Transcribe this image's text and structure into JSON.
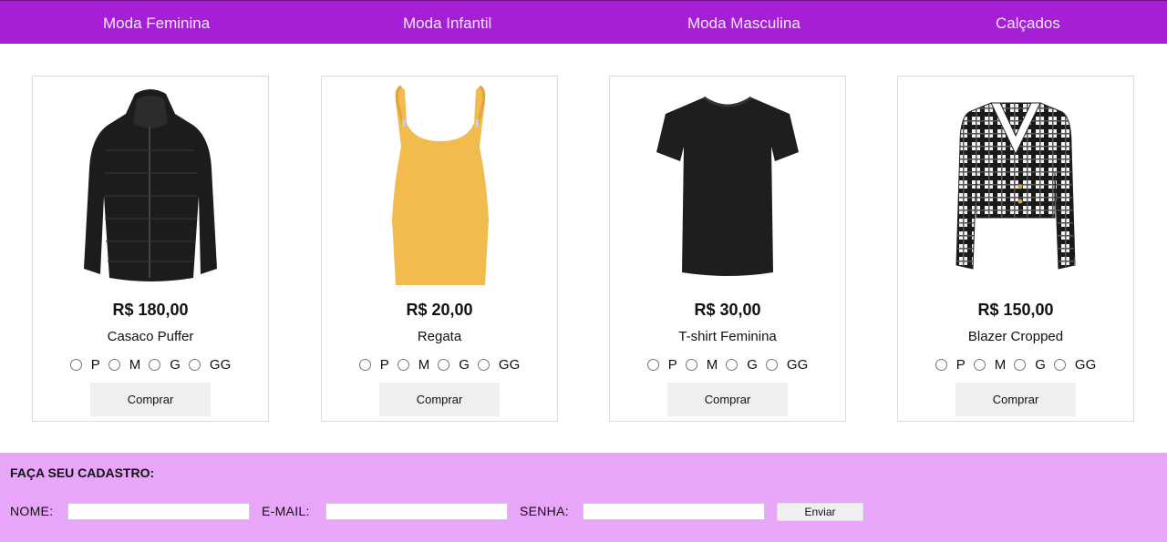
{
  "nav": {
    "items": [
      {
        "label": "Moda Feminina"
      },
      {
        "label": "Moda Infantil"
      },
      {
        "label": "Moda Masculina"
      },
      {
        "label": "Calçados"
      }
    ]
  },
  "products": [
    {
      "price": "R$ 180,00",
      "name": "Casaco Puffer",
      "buy_label": "Comprar",
      "image": "puffer-jacket-image"
    },
    {
      "price": "R$ 20,00",
      "name": "Regata",
      "buy_label": "Comprar",
      "image": "yellow-tank-top-image"
    },
    {
      "price": "R$ 30,00",
      "name": "T-shirt Feminina",
      "buy_label": "Comprar",
      "image": "black-tshirt-image"
    },
    {
      "price": "R$ 150,00",
      "name": "Blazer Cropped",
      "buy_label": "Comprar",
      "image": "plaid-blazer-image"
    }
  ],
  "sizes": [
    "P",
    "M",
    "G",
    "GG"
  ],
  "signup": {
    "title": "FAÇA SEU CADASTRO:",
    "name_label": "NOME:",
    "email_label": "E-MAIL:",
    "password_label": "SENHA:",
    "submit_label": "Enviar"
  },
  "colors": {
    "nav_bg": "#a61fd6",
    "signup_bg": "#e8a6f8",
    "button_bg": "#efefef"
  }
}
